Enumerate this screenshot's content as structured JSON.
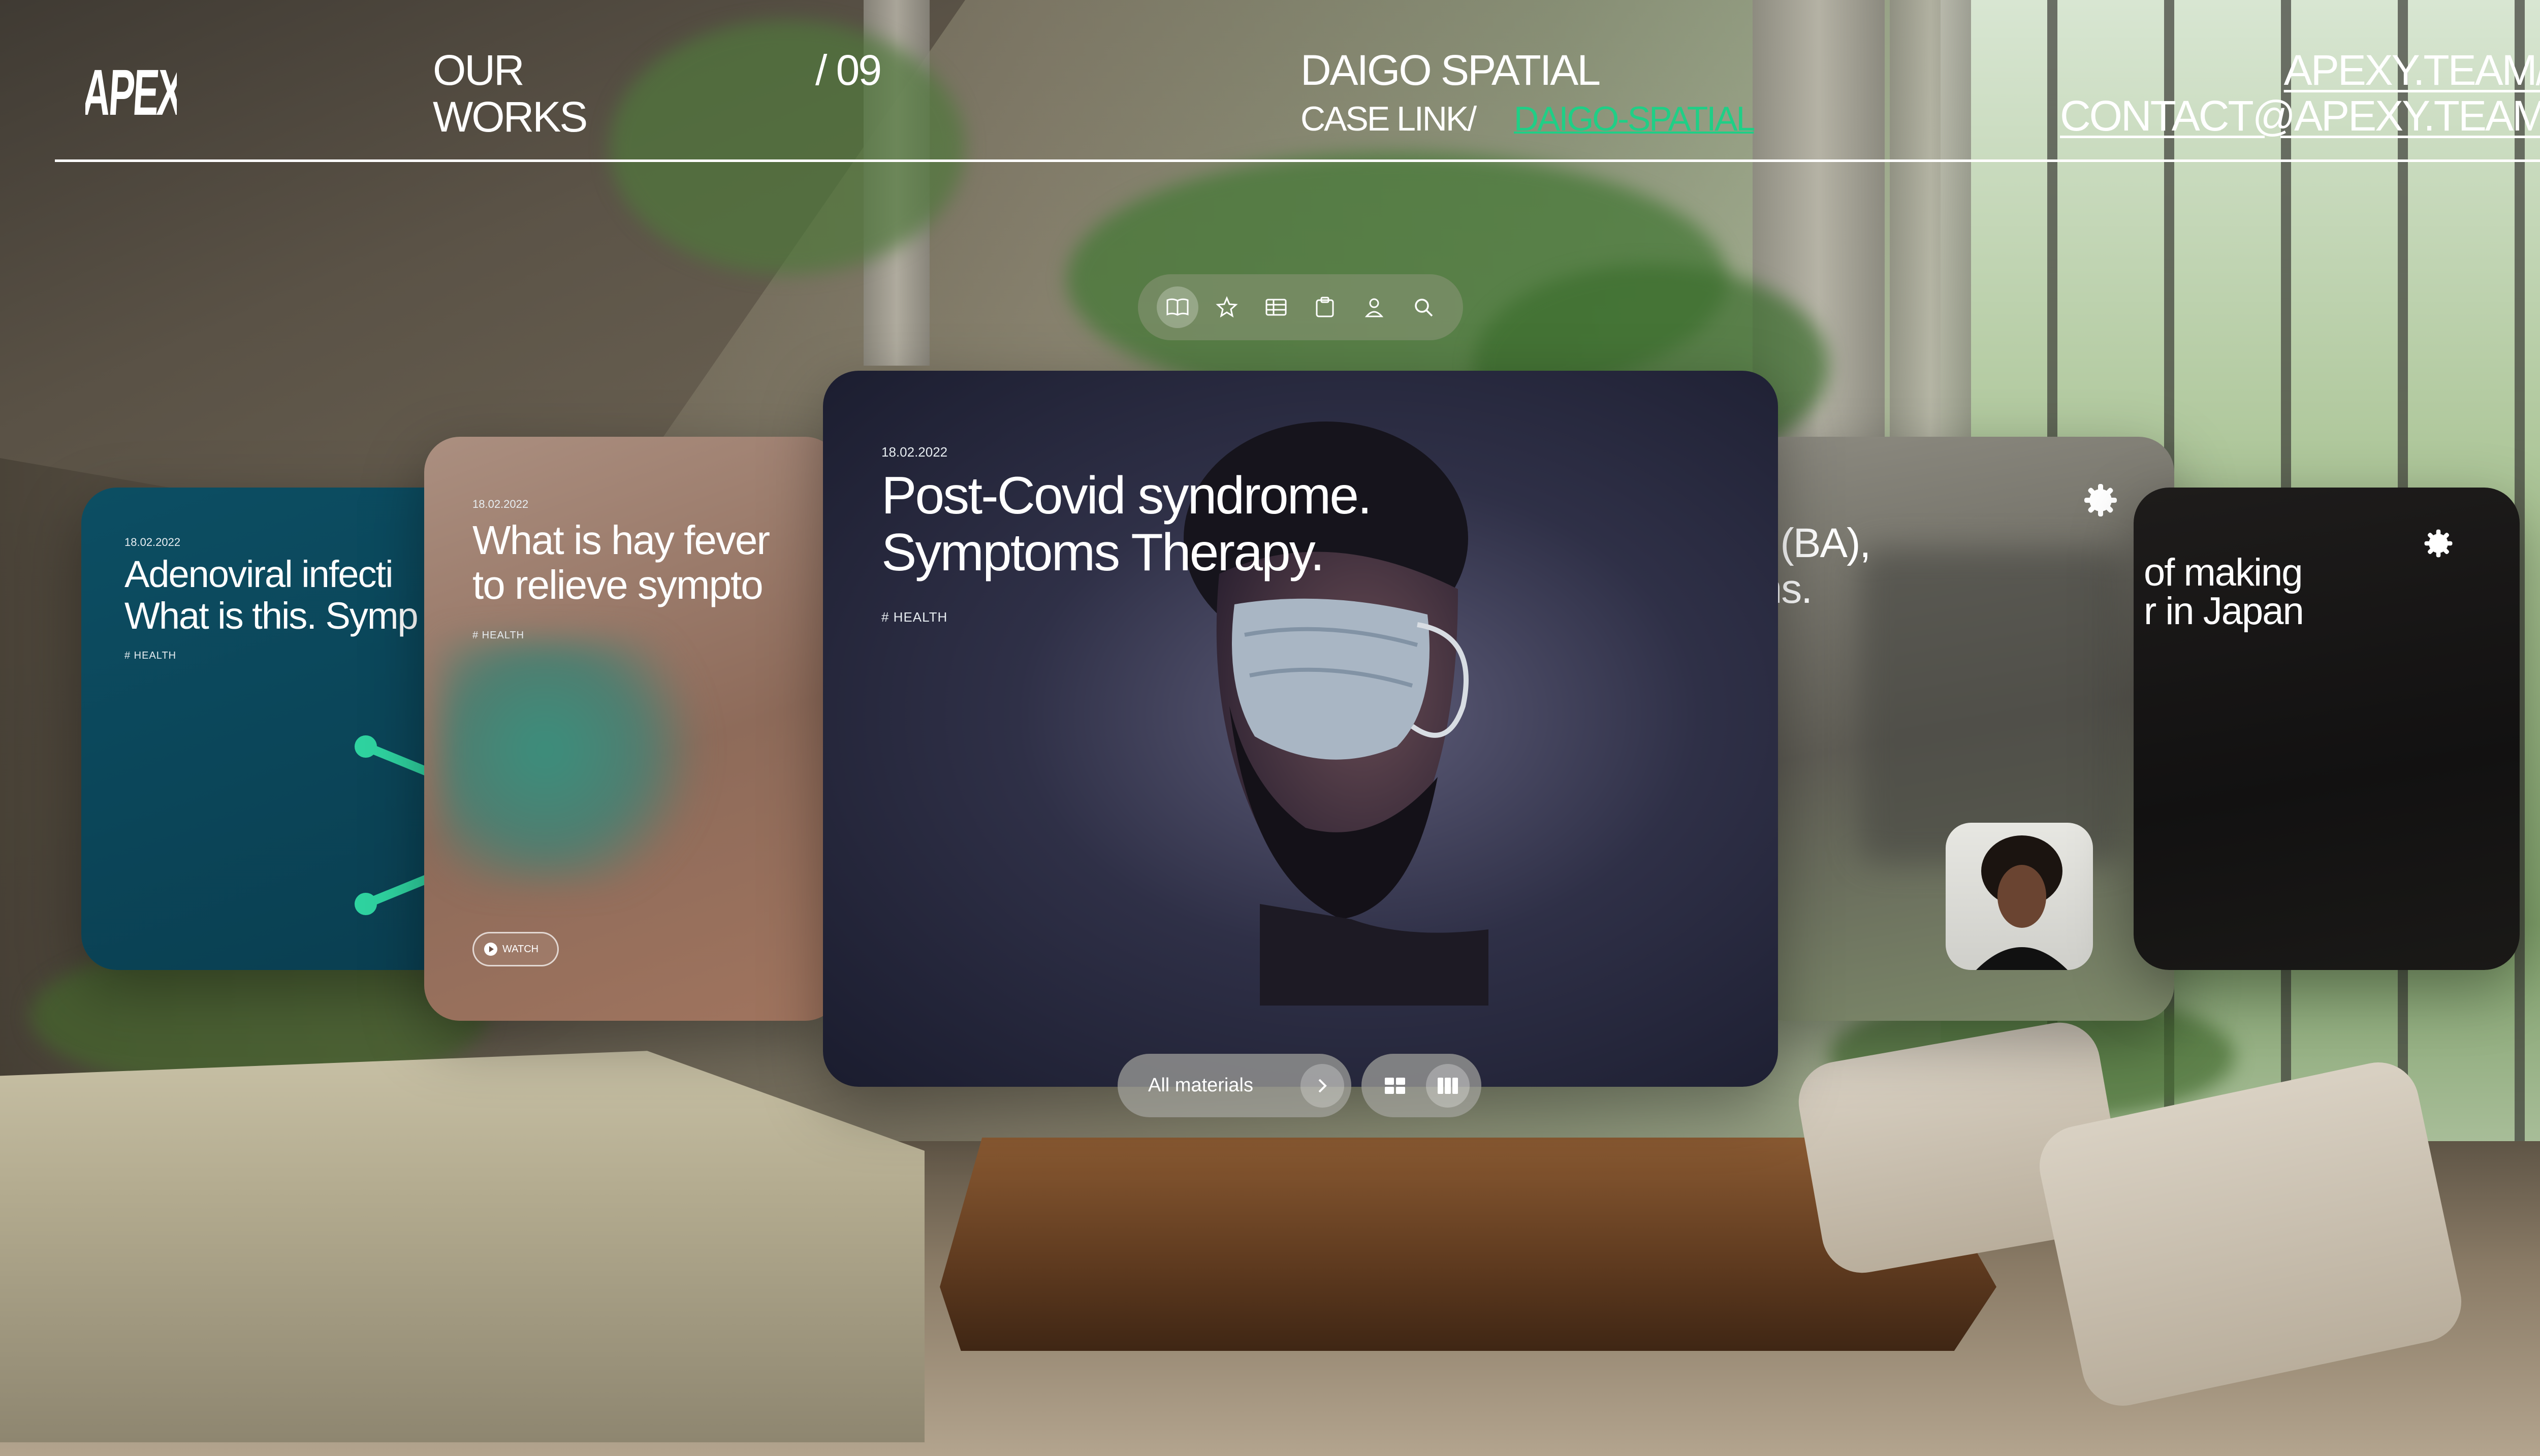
{
  "header": {
    "logo": "APEXY",
    "section_line1": "OUR",
    "section_line2": "WORKS",
    "counter": "/ 09",
    "project_title": "DAIGO SPATIAL",
    "case_link_label": "CASE LINK/",
    "case_link_value": "DAIGO-SPATIAL",
    "site_link": "APEXY.TEAM/",
    "contact_link": "CONTACT@APEXY.TEAM"
  },
  "toolbar": {
    "icons": [
      "book-icon",
      "star-icon",
      "table-icon",
      "clipboard-icon",
      "person-icon",
      "search-icon"
    ],
    "active_index": 0
  },
  "cards": {
    "adeno": {
      "date": "18.02.2022",
      "title_line1": "Adenoviral infecti",
      "title_line2": "What is this. Symp",
      "tag": "# HEALTH"
    },
    "hay": {
      "date": "18.02.2022",
      "title_line1": "What is hay fever",
      "title_line2": "to relieve sympto",
      "tag": "# HEALTH",
      "watch_label": "WATCH"
    },
    "main": {
      "date": "18.02.2022",
      "title_line1": "Post-Covid syndrome.",
      "title_line2": "Symptoms Therapy.",
      "tag": "# HEALTH"
    },
    "ba": {
      "title_line1": "a (BA),",
      "title_line2": "ms."
    },
    "japan": {
      "title_line1": "of making",
      "title_line2": "r in Japan"
    }
  },
  "controls": {
    "all_materials_label": "All materials",
    "view_icons": [
      "grid-view-icon",
      "column-view-icon"
    ],
    "active_view": 1
  },
  "colors": {
    "accent_green": "#1fcf86",
    "card_teal": "#0c4e63",
    "card_dark": "#1a1c2e"
  }
}
